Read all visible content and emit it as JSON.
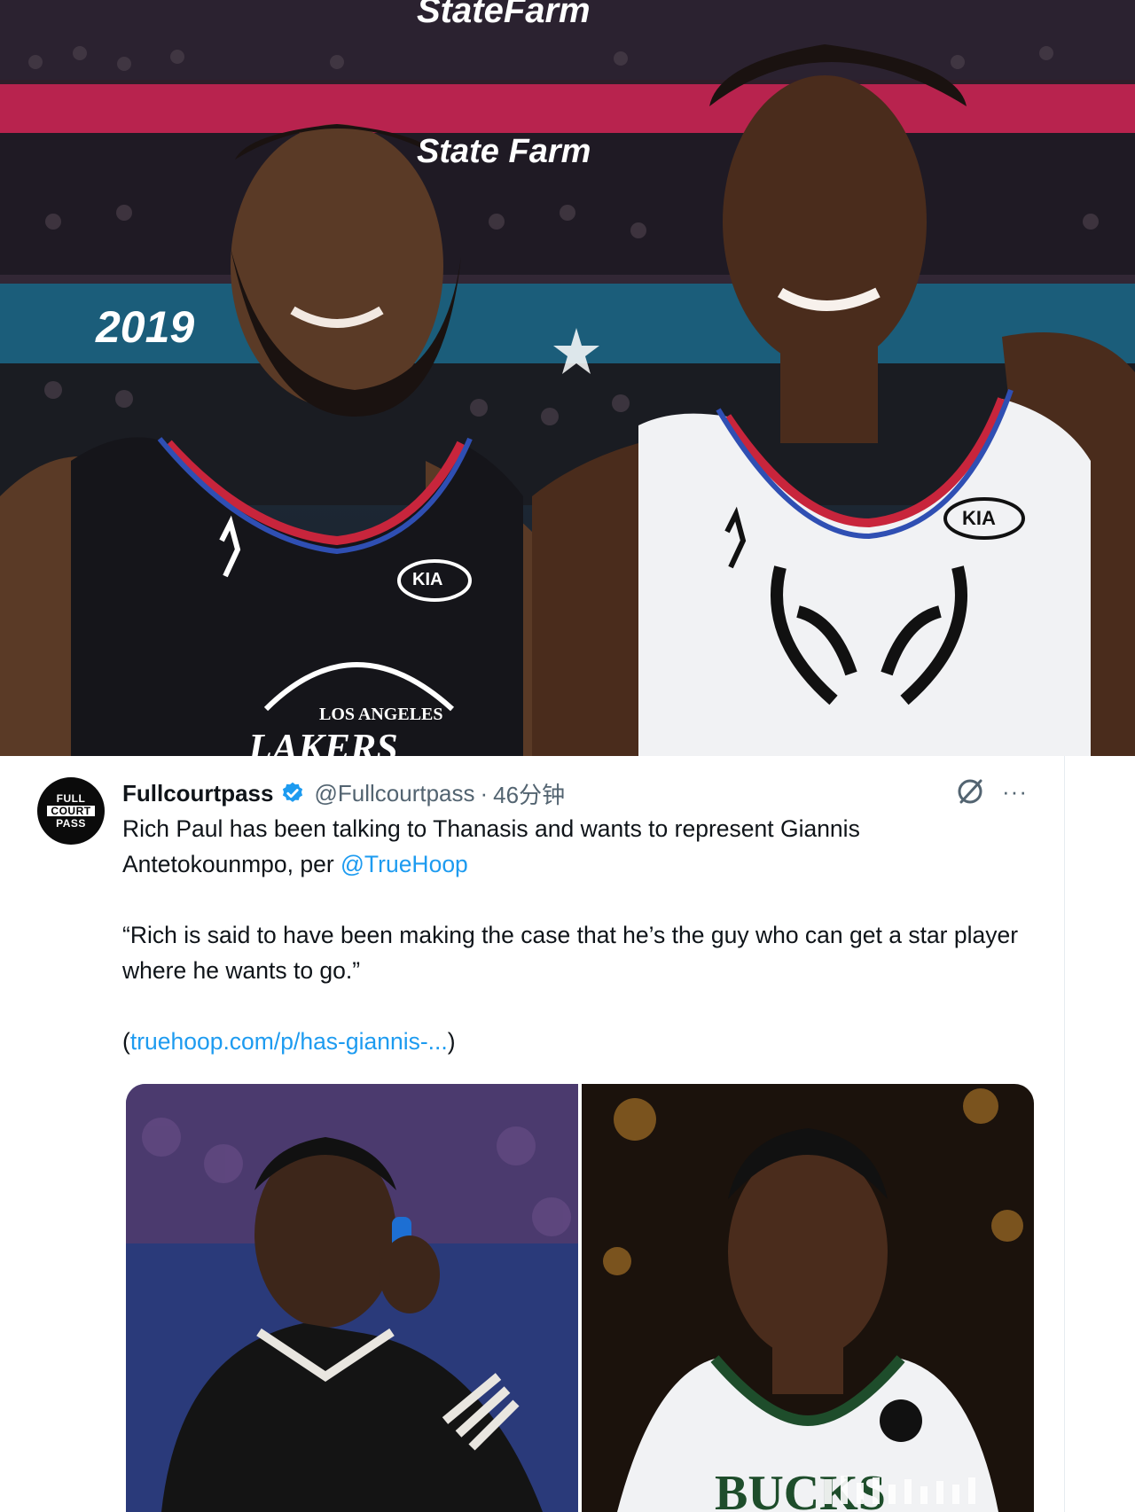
{
  "hero": {
    "banner_statefarm_top": "StateFarm",
    "banner_statefarm_mid": "State Farm",
    "year_banner": "2019",
    "jersey_left_logo": "KIA",
    "jersey_right_logo": "KIA",
    "jersey_left_team": "LOS ANGELES",
    "jersey_left_team_word": "LAKERS"
  },
  "tweet": {
    "avatar": {
      "line1": "FULL",
      "line2": "COURT",
      "line3": "PASS"
    },
    "author_name": "Fullcourtpass",
    "handle": "@Fullcourtpass",
    "separator": "·",
    "time": "46分钟",
    "more": "···",
    "text_line1_pre": "Rich Paul has been talking to Thanasis and wants to represent Giannis Antetokounmpo, per ",
    "mention": "@TrueHoop",
    "quote": "“Rich is said to have been making the case that he’s the guy who can get a star player where he wants to go.”",
    "link_open": "(",
    "link_text": "truehoop.com/p/has-giannis-...",
    "link_close": ")",
    "media_right_jersey": "BUCKS"
  },
  "colors": {
    "link": "#1d9bf0",
    "text": "#0f1419",
    "muted": "#536471",
    "verified": "#1d9bf0"
  },
  "icons": [
    "verified-badge-icon",
    "grok-icon",
    "more-icon",
    "analytics-bars-icon"
  ]
}
